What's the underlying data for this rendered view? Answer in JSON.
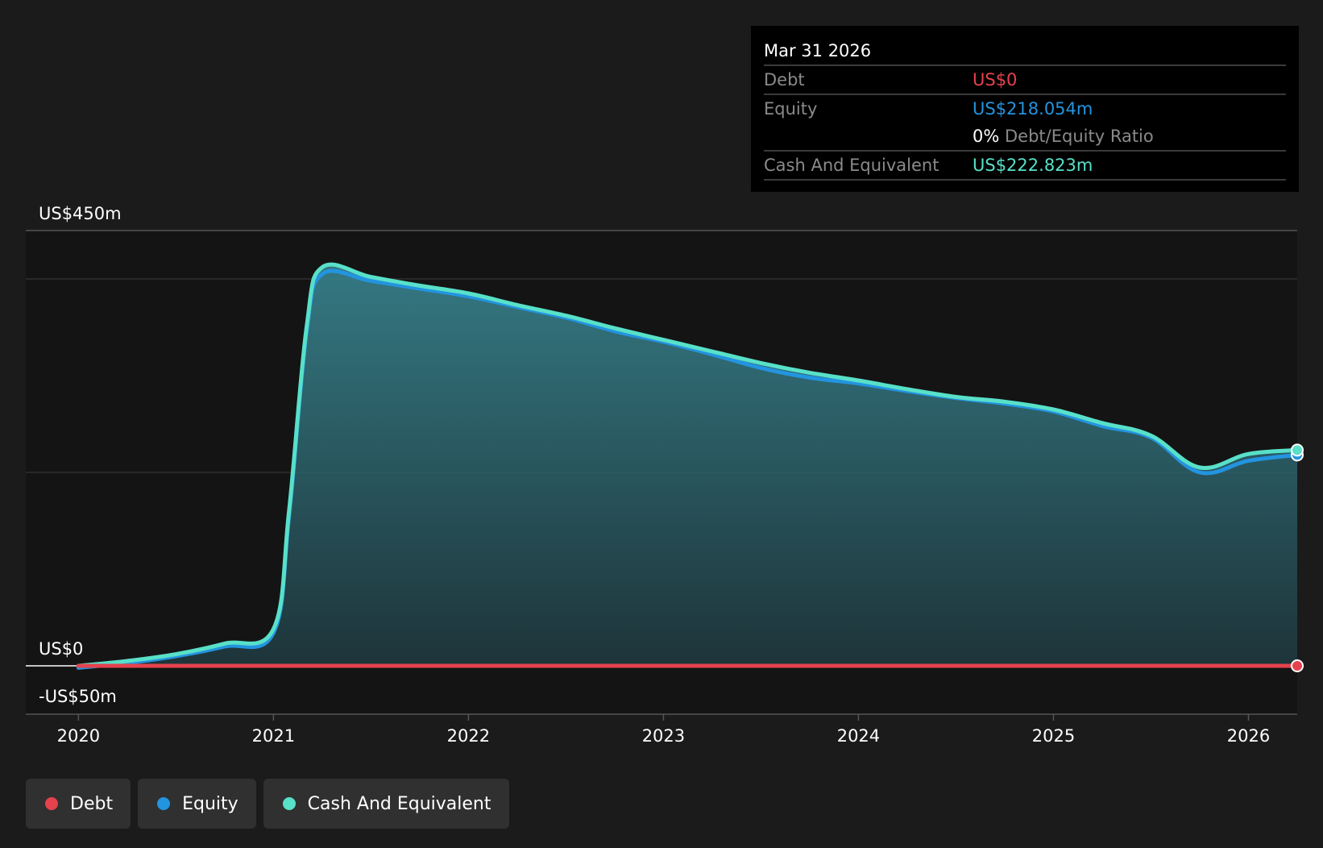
{
  "colors": {
    "debt": "#e5424d",
    "equity": "#2394df",
    "cash": "#58e0c8",
    "background": "#1b1b1b",
    "tooltip_bg": "#000000"
  },
  "tooltip": {
    "date": "Mar 31 2026",
    "debt_label": "Debt",
    "debt_value": "US$0",
    "equity_label": "Equity",
    "equity_value": "US$218.054m",
    "ratio_value": "0%",
    "ratio_label": "Debt/Equity Ratio",
    "cash_label": "Cash And Equivalent",
    "cash_value": "US$222.823m"
  },
  "legend": [
    {
      "label": "Debt",
      "color": "#e5424d"
    },
    {
      "label": "Equity",
      "color": "#2394df"
    },
    {
      "label": "Cash And Equivalent",
      "color": "#58e0c8"
    }
  ],
  "chart_data": {
    "type": "area",
    "title": "",
    "xlabel": "",
    "ylabel": "",
    "y_ticks": [
      {
        "value": 450,
        "label": "US$450m"
      },
      {
        "value": 0,
        "label": "US$0"
      },
      {
        "value": -50,
        "label": "-US$50m"
      }
    ],
    "ylim": [
      -50,
      450
    ],
    "xlim": [
      2019.73,
      2026.25
    ],
    "x_ticks": [
      {
        "value": 2020,
        "label": "2020"
      },
      {
        "value": 2021,
        "label": "2021"
      },
      {
        "value": 2022,
        "label": "2022"
      },
      {
        "value": 2023,
        "label": "2023"
      },
      {
        "value": 2024,
        "label": "2024"
      },
      {
        "value": 2025,
        "label": "2025"
      },
      {
        "value": 2026,
        "label": "2026"
      }
    ],
    "grid": true,
    "legend_position": "bottom-left",
    "series": [
      {
        "name": "Debt",
        "x": [
          2020.0,
          2026.25
        ],
        "values": [
          0,
          0
        ]
      },
      {
        "name": "Equity",
        "x": [
          2020.0,
          2020.25,
          2020.5,
          2020.75,
          2021.0,
          2021.08,
          2021.17,
          2021.25,
          2021.5,
          2021.75,
          2022.0,
          2022.25,
          2022.5,
          2022.75,
          2023.0,
          2023.25,
          2023.5,
          2023.75,
          2024.0,
          2024.25,
          2024.5,
          2024.75,
          2025.0,
          2025.25,
          2025.5,
          2025.75,
          2026.0,
          2026.25
        ],
        "values": [
          -2,
          3,
          10,
          20,
          34,
          155,
          345,
          405,
          398,
          390,
          382,
          371,
          360,
          346,
          335,
          322,
          308,
          298,
          292,
          284,
          277,
          271,
          263,
          248,
          236,
          200,
          212,
          218
        ]
      },
      {
        "name": "Cash And Equivalent",
        "x": [
          2020.0,
          2020.25,
          2020.5,
          2020.75,
          2021.0,
          2021.08,
          2021.17,
          2021.25,
          2021.5,
          2021.75,
          2022.0,
          2022.25,
          2022.5,
          2022.75,
          2023.0,
          2023.25,
          2023.5,
          2023.75,
          2024.0,
          2024.25,
          2024.5,
          2024.75,
          2025.0,
          2025.25,
          2025.5,
          2025.75,
          2026.0,
          2026.25
        ],
        "values": [
          0,
          5,
          12,
          23,
          38,
          160,
          350,
          412,
          402,
          393,
          385,
          373,
          362,
          349,
          337,
          325,
          313,
          303,
          295,
          286,
          278,
          273,
          265,
          251,
          238,
          205,
          219,
          223
        ]
      }
    ]
  }
}
